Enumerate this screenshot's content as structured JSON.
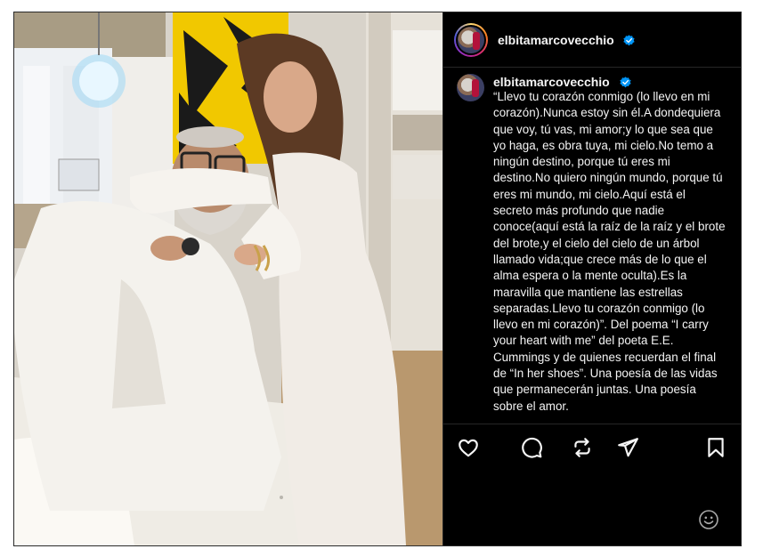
{
  "post": {
    "author": "elbitamarcovecchio",
    "verified": true,
    "caption": "“Llevo tu corazón conmigo (lo llevo en mi corazón).Nunca estoy sin él.A dondequiera que voy, tú vas, mi amor;y lo que sea que yo haga, es obra tuya, mi cielo.No temo a ningún destino, porque tú eres mi destino.No quiero ningún mundo, porque tú eres mi mundo, mi cielo.Aquí está el secreto más profundo que nadie conoce(aquí está la raíz de la raíz y el brote del brote,y el cielo del cielo de un árbol llamado vida;que crece más de lo que el alma espera o la mente oculta).Es la maravilla que mantiene las estrellas separadas.Llevo tu corazón conmigo (lo llevo en mi corazón)”. Del poema “I carry your heart with me” del poeta E.E. Cummings y de quienes recuerdan el final de “In her shoes”. Una poesía de las vidas que permanecerán juntas. Una poesía sobre el amor."
  },
  "icons": {
    "verified": "verified-badge-icon",
    "like": "heart-icon",
    "comment": "comment-bubble-icon",
    "share": "repost-icon",
    "send": "paper-plane-icon",
    "save": "bookmark-icon",
    "emoji": "emoji-smile-icon"
  },
  "colors": {
    "background": "#000000",
    "text": "#f5f5f5",
    "verified": "#0095f6",
    "divider": "#262626"
  }
}
